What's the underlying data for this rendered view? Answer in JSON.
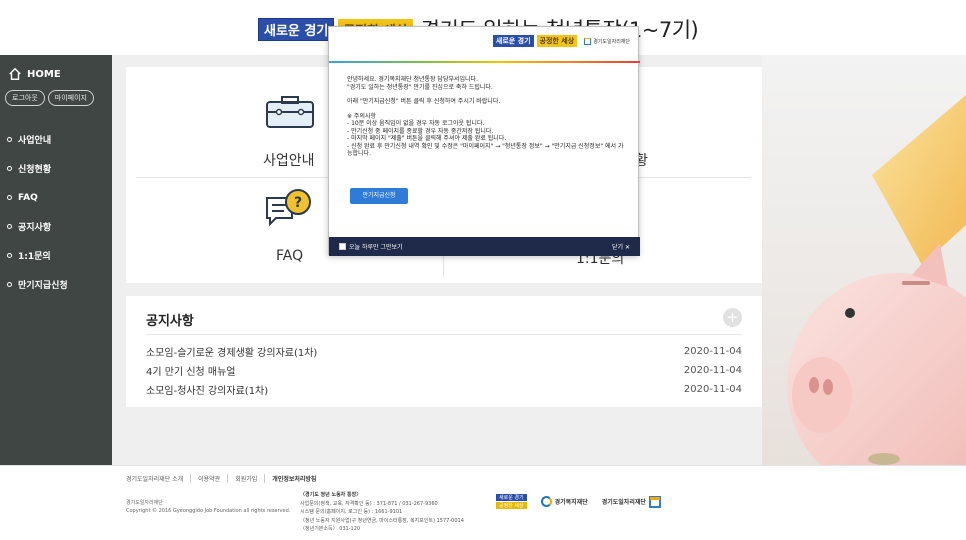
{
  "banner": {
    "badge1": "새로운 경기",
    "badge2": "공정한 세상",
    "title": "경기도 일하는 청년통장(1~7기)"
  },
  "sidebar": {
    "home": "HOME",
    "logout": "로그아웃",
    "mypage": "마이페이지",
    "items": [
      {
        "label": "사업안내"
      },
      {
        "label": "신청현황"
      },
      {
        "label": "FAQ"
      },
      {
        "label": "공지사항"
      },
      {
        "label": "1:1문의"
      },
      {
        "label": "만기지급신청"
      }
    ]
  },
  "services": {
    "business": "사업안내",
    "status_partial": "황",
    "faq": "FAQ",
    "inquiry": "1:1문의"
  },
  "notices": {
    "title": "공지사항",
    "plus": "+",
    "items": [
      {
        "title": "소모임-슬기로운 경제생활 강의자료(1차)",
        "date": "2020-11-04"
      },
      {
        "title": "4기 만기 신청 매뉴얼",
        "date": "2020-11-04"
      },
      {
        "title": "소모임-청사진 강의자료(1차)",
        "date": "2020-11-04"
      }
    ]
  },
  "popup": {
    "badge1": "새로운 경기",
    "badge2": "공정한 세상",
    "org": "경기도일자리재단",
    "greeting1": "안녕하세요. 경기복지재단 청년통장 담당부서입니다.",
    "greeting2": "\"경기도 일하는 청년통장\" 만기를 진심으로 축하 드립니다.",
    "instruction": "아래 \"만기지급신청\" 버튼 클릭 후 신청하여 주시기 바랍니다.",
    "notes_title": "※ 주의사항",
    "note1": "- 10분 이상 움직임이 없을 경우 자동 로그아웃 됩니다.",
    "note2": "- 만기신청 중 페이지를 종료할 경우 자동 중간저장 됩니다.",
    "note3": "- 마지막 페이지 \"제출\" 버튼을 클릭해 주셔야 제출 완료 됩니다.",
    "note4": "- 신청 완료 후 만기신청 내역 확인 및 수정은 \"마이페이지\" → \"청년통장 정보\" → \"만기지급 신청정보\" 에서 가능합니다.",
    "button": "만기지급신청",
    "dont_show": "오늘 하루만 그만보기",
    "close": "닫기 ✕"
  },
  "footer": {
    "links": [
      "경기도일자리재단 소개",
      "이용약관",
      "회원가입",
      "개인정보처리방침"
    ],
    "org_name": "경기도일자리재단",
    "copyright": "Copyright © 2016 Gyeonggido Job Foundation all rights reserved.",
    "contact1": "〈경기도 청년 노동자 통장〉",
    "contact2": "사업문의(정책, 교육, 자격확인 등) : 371-871 / 031-267-9360",
    "contact3": "시스템 문의(홈페이지, 로그인 등) : 1661-9101",
    "contact4": "〈청년 노동자 지원사업(구 청년연금, 마이스터통장, 복지포인트) 1577-0014",
    "contact5": "〈청년기본소득〉 031-120",
    "logo_badge1": "새로운 경기",
    "logo_badge2": "공정한 세상",
    "logo2": "경기복지재단",
    "logo3": "경기도일자리재단"
  },
  "colors": {
    "sidebar": "#3f4643",
    "accent_blue": "#2f7bd8",
    "popup_footer": "#1f2a4a"
  }
}
